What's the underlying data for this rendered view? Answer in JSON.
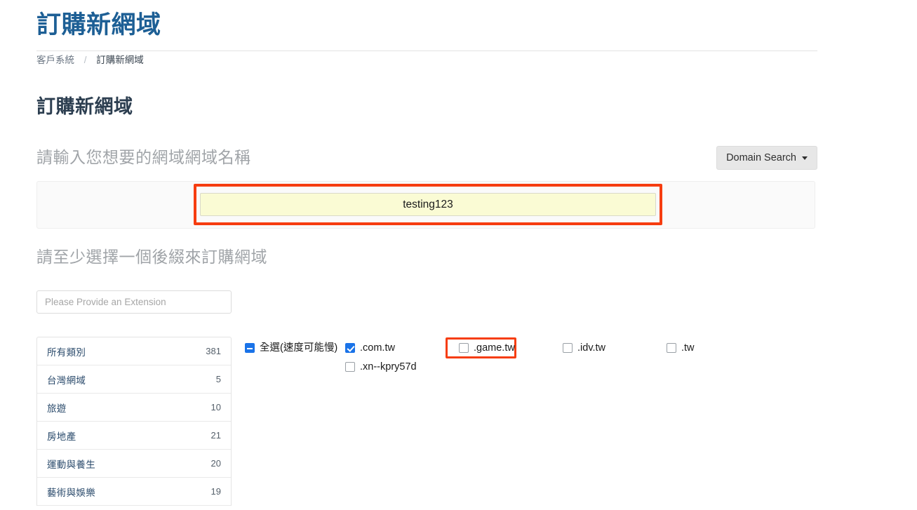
{
  "header": {
    "title": "訂購新網域"
  },
  "breadcrumb": {
    "root": "客戶系統",
    "separator": "/",
    "current": "訂購新網域"
  },
  "section": {
    "title": "訂購新網域"
  },
  "search": {
    "prompt": "請輸入您想要的網域網域名稱",
    "button_label": "Domain Search",
    "button_caret_icon": "caret-down-icon",
    "input_value": "testing123",
    "input_placeholder": "",
    "highlight_color": "#f63d10",
    "input_background": "#fafbd4"
  },
  "extensions": {
    "prompt": "請至少選擇一個後綴來訂購網域",
    "filter_placeholder": "Please Provide an Extension",
    "filter_value": "",
    "select_all": {
      "label": "全選(速度可能慢)",
      "state": "indeterminate"
    },
    "items": [
      {
        "label": ".com.tw",
        "checked": true,
        "highlighted": true
      },
      {
        "label": ".game.tw",
        "checked": false,
        "highlighted": false
      },
      {
        "label": ".idv.tw",
        "checked": false,
        "highlighted": false
      },
      {
        "label": ".tw",
        "checked": false,
        "highlighted": false
      },
      {
        "label": ".xn--kpry57d",
        "checked": false,
        "highlighted": false
      }
    ]
  },
  "categories": {
    "rows": [
      {
        "name": "所有類別",
        "count": "381"
      },
      {
        "name": "台灣網域",
        "count": "5"
      },
      {
        "name": "旅遊",
        "count": "10"
      },
      {
        "name": "房地產",
        "count": "21"
      },
      {
        "name": "運動與養生",
        "count": "20"
      },
      {
        "name": "藝術與娛樂",
        "count": "19"
      }
    ]
  },
  "colors": {
    "brand_blue": "#1d5f95",
    "heading_dark": "#2c3e50",
    "muted": "#a0a4a8",
    "accent_red": "#f63d10",
    "checkbox_blue": "#1a73e8"
  }
}
